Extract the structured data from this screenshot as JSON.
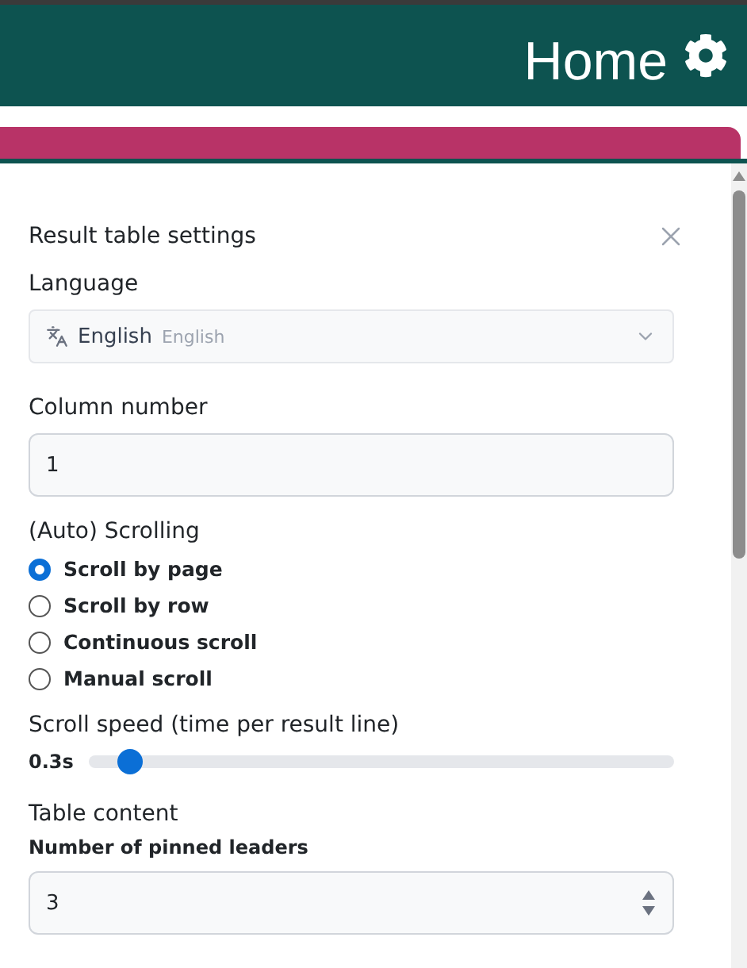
{
  "header": {
    "title": "Home"
  },
  "panel": {
    "title": "Result table settings",
    "language": {
      "label": "Language",
      "value": "English",
      "native": "English"
    },
    "column_number": {
      "label": "Column number",
      "value": "1"
    },
    "scrolling": {
      "label": "(Auto) Scrolling",
      "options": [
        {
          "label": "Scroll by page",
          "selected": true
        },
        {
          "label": "Scroll by row",
          "selected": false
        },
        {
          "label": "Continuous scroll",
          "selected": false
        },
        {
          "label": "Manual scroll",
          "selected": false
        }
      ]
    },
    "scroll_speed": {
      "label": "Scroll speed (time per result line)",
      "reading": "0.3s",
      "level": 0.07
    },
    "table_content": {
      "label": "Table content",
      "pinned_leaders": {
        "label": "Number of pinned leaders",
        "value": "3"
      }
    }
  }
}
